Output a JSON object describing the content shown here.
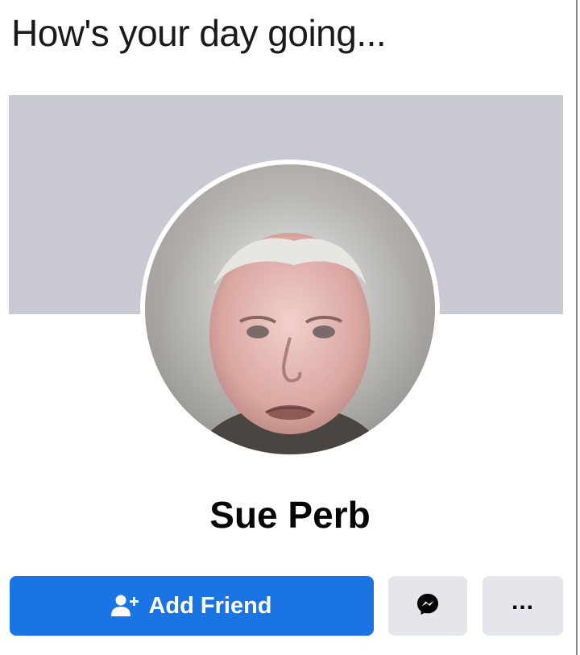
{
  "caption": "How's your day going...",
  "profile": {
    "name": "Sue Perb"
  },
  "actions": {
    "add_friend_label": "Add Friend",
    "add_friend_icon": "add-friend-icon",
    "messenger_icon": "messenger-icon",
    "more_label": "..."
  },
  "colors": {
    "primary_button": "#1b74e4",
    "secondary_button": "#e4e6eb",
    "cover": "#c9c9d3"
  }
}
